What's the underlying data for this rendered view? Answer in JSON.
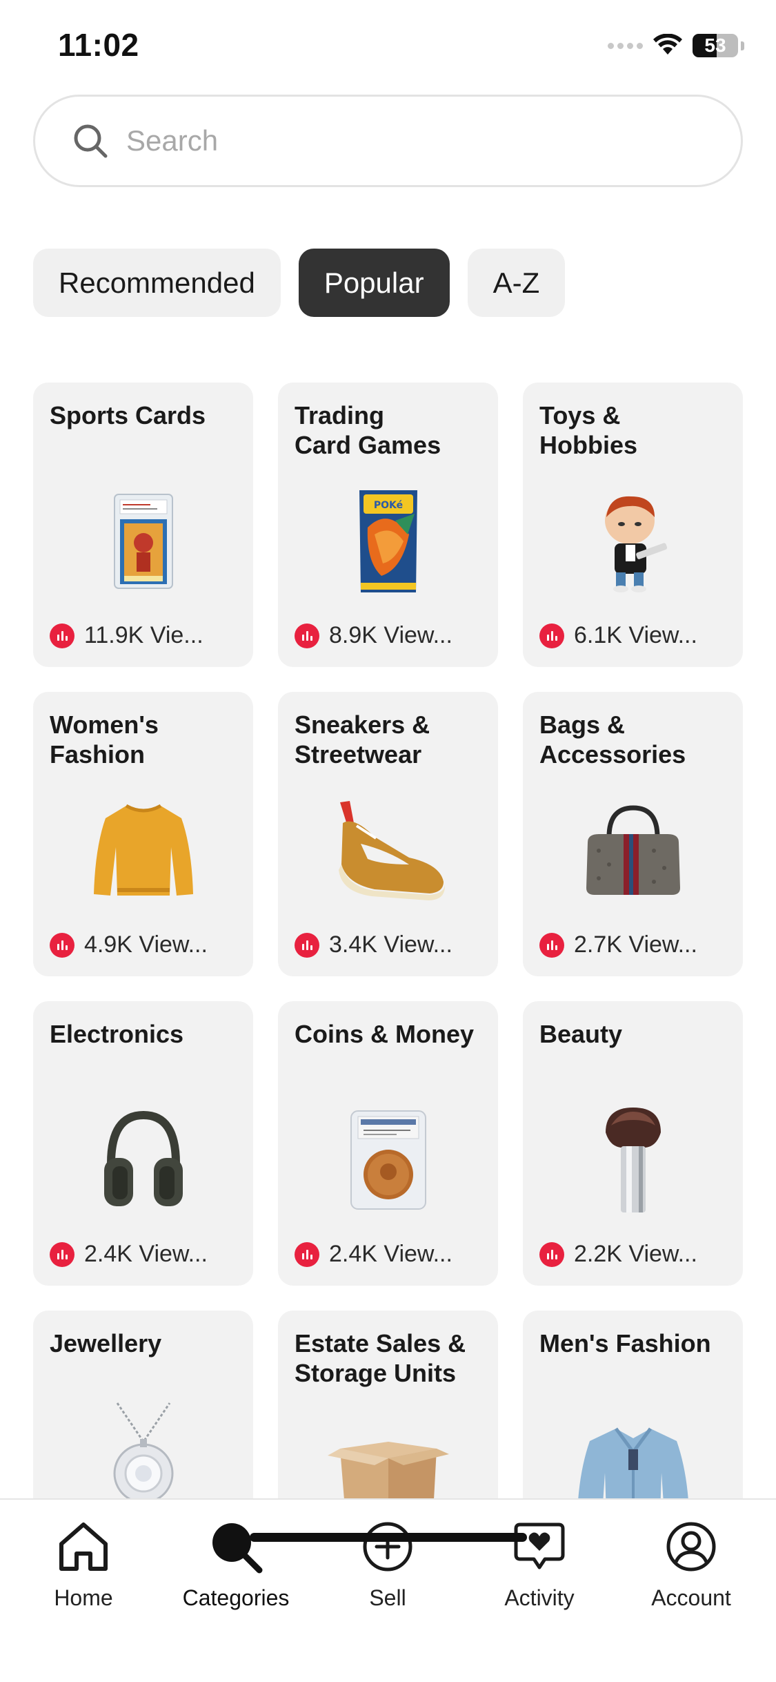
{
  "status_bar": {
    "time": "11:02",
    "battery_level": "53",
    "battery_fraction": 0.53
  },
  "search": {
    "placeholder": "Search",
    "value": ""
  },
  "tabs": [
    {
      "label": "Recommended",
      "active": false
    },
    {
      "label": "Popular",
      "active": true
    },
    {
      "label": "A-Z",
      "active": false
    }
  ],
  "categories": [
    {
      "title": "Sports Cards",
      "views": "11.9K Vie...",
      "icon": "graded-card-icon"
    },
    {
      "title": "Trading\nCard Games",
      "views": "8.9K View...",
      "icon": "card-pack-icon"
    },
    {
      "title": "Toys &\nHobbies",
      "views": "6.1K View...",
      "icon": "figure-toy-icon"
    },
    {
      "title": "Women's\nFashion",
      "views": "4.9K View...",
      "icon": "sweater-icon"
    },
    {
      "title": "Sneakers &\nStreetwear",
      "views": "3.4K View...",
      "icon": "sneaker-icon"
    },
    {
      "title": "Bags &\nAccessories",
      "views": "2.7K View...",
      "icon": "handbag-icon"
    },
    {
      "title": "Electronics",
      "views": "2.4K View...",
      "icon": "headphones-icon"
    },
    {
      "title": "Coins & Money",
      "views": "2.4K View...",
      "icon": "graded-coin-icon"
    },
    {
      "title": "Beauty",
      "views": "2.2K View...",
      "icon": "makeup-brush-icon"
    },
    {
      "title": "Jewellery",
      "views": "",
      "icon": "necklace-icon"
    },
    {
      "title": "Estate Sales &\nStorage Units",
      "views": "",
      "icon": "cardboard-box-icon"
    },
    {
      "title": "Men's Fashion",
      "views": "",
      "icon": "jacket-icon"
    }
  ],
  "bottom_nav": {
    "items": [
      {
        "label": "Home",
        "icon": "home-icon",
        "active": false
      },
      {
        "label": "Categories",
        "icon": "categories-search-icon",
        "active": true
      },
      {
        "label": "Sell",
        "icon": "plus-circle-icon",
        "active": false
      },
      {
        "label": "Activity",
        "icon": "heart-chat-icon",
        "active": false
      },
      {
        "label": "Account",
        "icon": "user-circle-icon",
        "active": false
      }
    ]
  },
  "colors": {
    "accent": "#e8213f",
    "active_tab": "#333333",
    "card_bg": "#f2f2f2"
  }
}
